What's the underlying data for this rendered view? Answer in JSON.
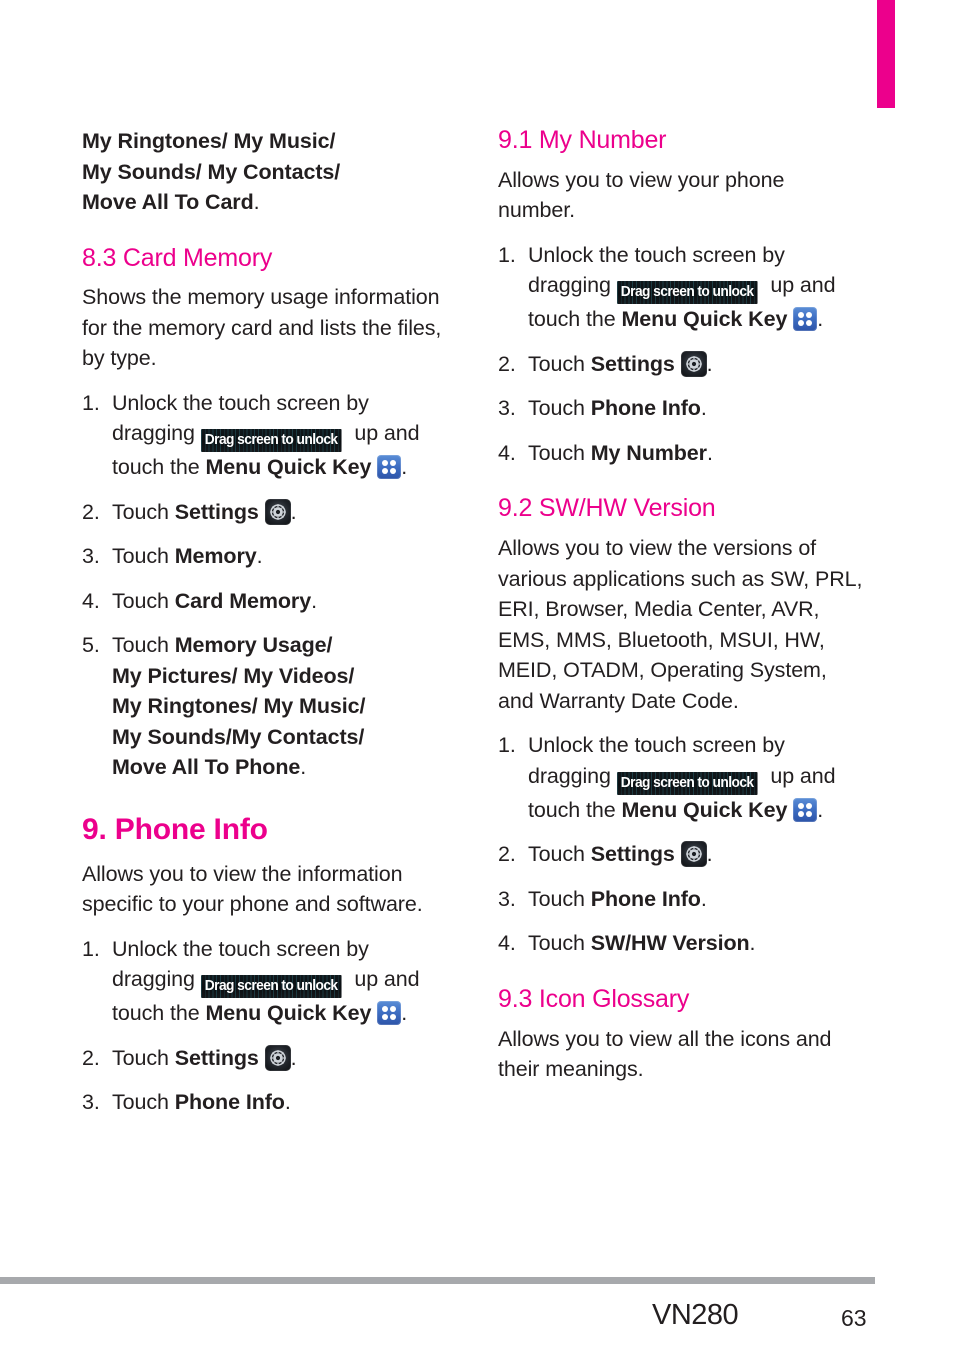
{
  "colors": {
    "heading_magenta": "#ec008c",
    "body_text": "#231f20",
    "footer_rule": "#a7a9ac",
    "menu_key_blue": "#3f6fc4",
    "drag_badge_dark": "#0a0e11"
  },
  "tab_marker": {
    "name": "chapter-tab-marker",
    "color": "#ec008c"
  },
  "icons": {
    "drag_badge_label": "Drag screen to unlock",
    "menu_quick_key": "menu-quick-key-icon",
    "settings_gear": "settings-gear-icon"
  },
  "left_column": {
    "continued_list": {
      "line1": "My Ringtones/ My Music/",
      "line2": "My Sounds/ My Contacts/",
      "line3": "Move All To Card",
      "line3_tail": "."
    },
    "section_8_3": {
      "heading": "8.3 Card Memory",
      "intro": "Shows the memory usage information for the memory card and lists the files, by type.",
      "steps": [
        {
          "num": "1.",
          "p1": "Unlock the touch screen by dragging ",
          "p2": " up and touch the ",
          "bold": "Menu Quick Key",
          "p3": "."
        },
        {
          "num": "2.",
          "p1": "Touch ",
          "bold": "Settings",
          "p3": "."
        },
        {
          "num": "3.",
          "p1": "Touch ",
          "bold": "Memory",
          "p3": "."
        },
        {
          "num": "4.",
          "p1": "Touch ",
          "bold": "Card Memory",
          "p3": "."
        },
        {
          "num": "5.",
          "p1": "Touch ",
          "bold_lines": [
            "Memory Usage/",
            "My Pictures/ My Videos/",
            "My Ringtones/ My Music/",
            "My Sounds/My Contacts/",
            "Move All To Phone"
          ],
          "p3": "."
        }
      ]
    },
    "section_9": {
      "heading": "9. Phone Info",
      "intro": "Allows you to view the information specific to your phone and software.",
      "steps": [
        {
          "num": "1.",
          "p1": "Unlock the touch screen by dragging ",
          "p2": " up and touch the ",
          "bold": "Menu Quick Key",
          "p3": "."
        },
        {
          "num": "2.",
          "p1": "Touch ",
          "bold": "Settings",
          "p3": "."
        },
        {
          "num": "3.",
          "p1": "Touch ",
          "bold": "Phone Info",
          "p3": "."
        }
      ]
    }
  },
  "right_column": {
    "section_9_1": {
      "heading": "9.1 My Number",
      "intro": "Allows you to view your phone number.",
      "steps": [
        {
          "num": "1.",
          "p1": "Unlock the touch screen by dragging ",
          "p2": " up and touch the ",
          "bold": "Menu Quick Key",
          "p3": "."
        },
        {
          "num": "2.",
          "p1": "Touch ",
          "bold": "Settings",
          "p3": "."
        },
        {
          "num": "3.",
          "p1": "Touch ",
          "bold": "Phone Info",
          "p3": "."
        },
        {
          "num": "4.",
          "p1": "Touch ",
          "bold": "My Number",
          "p3": "."
        }
      ]
    },
    "section_9_2": {
      "heading": "9.2 SW/HW Version",
      "intro": "Allows you to view the versions of various applications such as SW, PRL, ERI, Browser, Media Center, AVR, EMS, MMS, Bluetooth, MSUI, HW, MEID, OTADM, Operating System, and Warranty Date Code.",
      "steps": [
        {
          "num": "1.",
          "p1": "Unlock the touch screen by dragging ",
          "p2": " up and touch the ",
          "bold": "Menu Quick Key",
          "p3": "."
        },
        {
          "num": "2.",
          "p1": "Touch ",
          "bold": "Settings",
          "p3": "."
        },
        {
          "num": "3.",
          "p1": "Touch ",
          "bold": "Phone Info",
          "p3": "."
        },
        {
          "num": "4.",
          "p1": "Touch ",
          "bold": "SW/HW Version",
          "p3": "."
        }
      ]
    },
    "section_9_3": {
      "heading": "9.3 Icon Glossary",
      "intro": "Allows you to view all the icons and their meanings."
    }
  },
  "footer": {
    "model": "VN280",
    "page_number": "63"
  }
}
